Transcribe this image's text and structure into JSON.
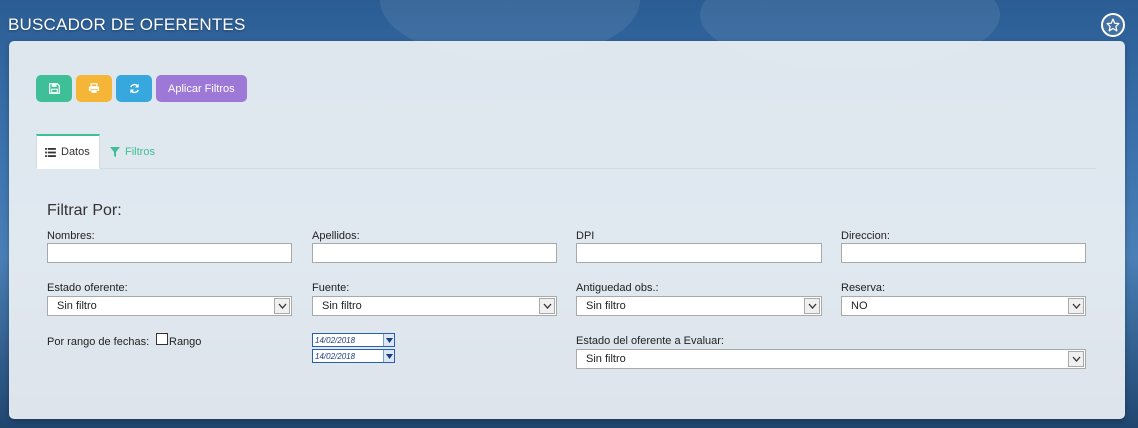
{
  "header": {
    "title": "BUSCADOR DE OFERENTES",
    "star_icon": "star-icon"
  },
  "toolbar": {
    "save_icon": "save-icon",
    "print_icon": "print-icon",
    "refresh_icon": "refresh-icon",
    "apply_label": "Aplicar Filtros"
  },
  "tabs": [
    {
      "label": "Datos",
      "icon": "list-icon",
      "active": true
    },
    {
      "label": "Filtros",
      "icon": "filter-icon",
      "active": false
    }
  ],
  "filters": {
    "title": "Filtrar Por:",
    "nombres": {
      "label": "Nombres:",
      "value": ""
    },
    "apellidos": {
      "label": "Apellidos:",
      "value": ""
    },
    "dpi": {
      "label": "DPI",
      "value": ""
    },
    "direccion": {
      "label": "Direccion:",
      "value": ""
    },
    "estado_oferente": {
      "label": "Estado oferente:",
      "selected": "Sin filtro"
    },
    "fuente": {
      "label": "Fuente:",
      "selected": "Sin filtro"
    },
    "antiguedad": {
      "label": "Antiguedad obs.:",
      "selected": "Sin filtro"
    },
    "reserva": {
      "label": "Reserva:",
      "selected": "NO"
    },
    "rango": {
      "label": "Por rango de fechas:",
      "checkbox_label": "Rango",
      "checked": false,
      "fecha_inicio": "14/02/2018",
      "fecha_fin": "14/02/2018"
    },
    "estado_evaluar": {
      "label": "Estado del oferente a Evaluar:",
      "selected": "Sin filtro"
    }
  },
  "colors": {
    "green": "#3fbf97",
    "orange": "#f5b638",
    "blue": "#36a8dd",
    "purple": "#9d78d6"
  }
}
